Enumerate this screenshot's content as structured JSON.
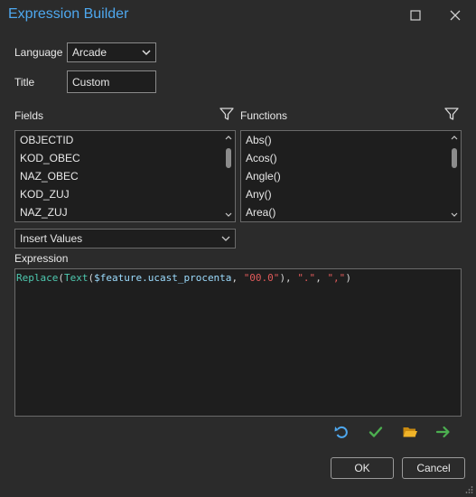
{
  "window": {
    "title": "Expression Builder"
  },
  "titlebar": {
    "maximize_icon": "square-icon",
    "close_icon": "close-icon"
  },
  "language": {
    "label": "Language",
    "value": "Arcade"
  },
  "title_field": {
    "label": "Title",
    "value": "Custom"
  },
  "fields": {
    "label": "Fields",
    "items": [
      "OBJECTID",
      "KOD_OBEC",
      "NAZ_OBEC",
      "KOD_ZUJ",
      "NAZ_ZUJ"
    ]
  },
  "functions": {
    "label": "Functions",
    "items": [
      "Abs()",
      "Acos()",
      "Angle()",
      "Any()",
      "Area()"
    ]
  },
  "insert_values": {
    "value": "Insert Values"
  },
  "expression": {
    "label": "Expression",
    "tokens": {
      "fn1": "Replace",
      "p1": "(",
      "fn2": "Text",
      "p2": "(",
      "var": "$feature.ucast_procenta",
      "p3": ", ",
      "s1": "\"00.0\"",
      "p4": "), ",
      "s2": "\".\"",
      "p5": ", ",
      "s3": "\",\"",
      "p6": ")"
    }
  },
  "toolbar": {
    "icons": [
      "undo-icon",
      "check-icon",
      "folder-icon",
      "arrow-right-icon"
    ]
  },
  "colors": {
    "accent": "#4ea8ef",
    "check": "#4caf50",
    "folder": "#e0a020",
    "arrow": "#4caf50",
    "undo": "#4ea8ef"
  },
  "buttons": {
    "ok": "OK",
    "cancel": "Cancel"
  }
}
